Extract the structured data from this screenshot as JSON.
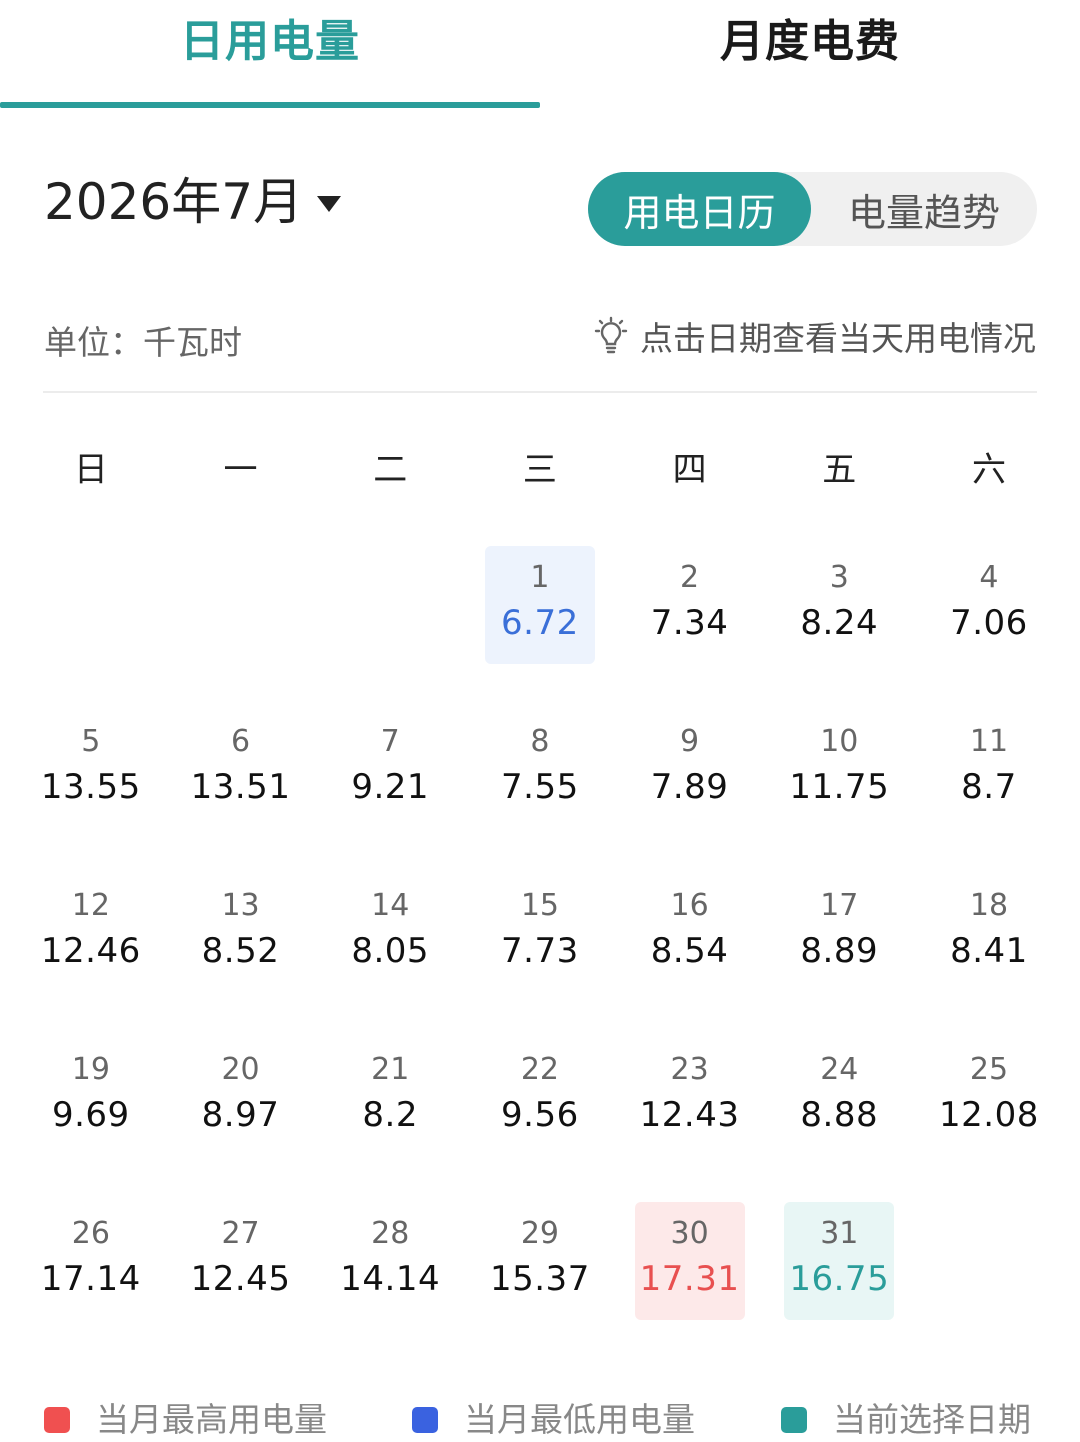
{
  "tabs": [
    {
      "label": "日用电量",
      "active": true
    },
    {
      "label": "月度电费",
      "active": false
    }
  ],
  "header": {
    "month_label": "2026年7月",
    "view_toggle": {
      "calendar_label": "用电日历",
      "trend_label": "电量趋势",
      "selected": "calendar"
    }
  },
  "info": {
    "unit_label": "单位：千瓦时",
    "hint_text": "点击日期查看当天用电情况"
  },
  "weekdays": [
    "日",
    "一",
    "二",
    "三",
    "四",
    "五",
    "六"
  ],
  "calendar": {
    "leading_blanks": 3,
    "days": [
      {
        "day": "1",
        "value": "6.72",
        "mark": "low"
      },
      {
        "day": "2",
        "value": "7.34"
      },
      {
        "day": "3",
        "value": "8.24"
      },
      {
        "day": "4",
        "value": "7.06"
      },
      {
        "day": "5",
        "value": "13.55"
      },
      {
        "day": "6",
        "value": "13.51"
      },
      {
        "day": "7",
        "value": "9.21"
      },
      {
        "day": "8",
        "value": "7.55"
      },
      {
        "day": "9",
        "value": "7.89"
      },
      {
        "day": "10",
        "value": "11.75"
      },
      {
        "day": "11",
        "value": "8.7"
      },
      {
        "day": "12",
        "value": "12.46"
      },
      {
        "day": "13",
        "value": "8.52"
      },
      {
        "day": "14",
        "value": "8.05"
      },
      {
        "day": "15",
        "value": "7.73"
      },
      {
        "day": "16",
        "value": "8.54"
      },
      {
        "day": "17",
        "value": "8.89"
      },
      {
        "day": "18",
        "value": "8.41"
      },
      {
        "day": "19",
        "value": "9.69"
      },
      {
        "day": "20",
        "value": "8.97"
      },
      {
        "day": "21",
        "value": "8.2"
      },
      {
        "day": "22",
        "value": "9.56"
      },
      {
        "day": "23",
        "value": "12.43"
      },
      {
        "day": "24",
        "value": "8.88"
      },
      {
        "day": "25",
        "value": "12.08"
      },
      {
        "day": "26",
        "value": "17.14"
      },
      {
        "day": "27",
        "value": "12.45"
      },
      {
        "day": "28",
        "value": "14.14"
      },
      {
        "day": "29",
        "value": "15.37"
      },
      {
        "day": "30",
        "value": "17.31",
        "mark": "high"
      },
      {
        "day": "31",
        "value": "16.75",
        "mark": "selected"
      }
    ]
  },
  "legend": [
    {
      "label": "当月最高用电量",
      "color": "#f05050"
    },
    {
      "label": "当月最低用电量",
      "color": "#3a62e0"
    },
    {
      "label": "当前选择日期",
      "color": "#2a9d9a"
    }
  ],
  "colors": {
    "accent": "#2a9d9a",
    "high": "#e85050",
    "low": "#3a6fd8"
  }
}
